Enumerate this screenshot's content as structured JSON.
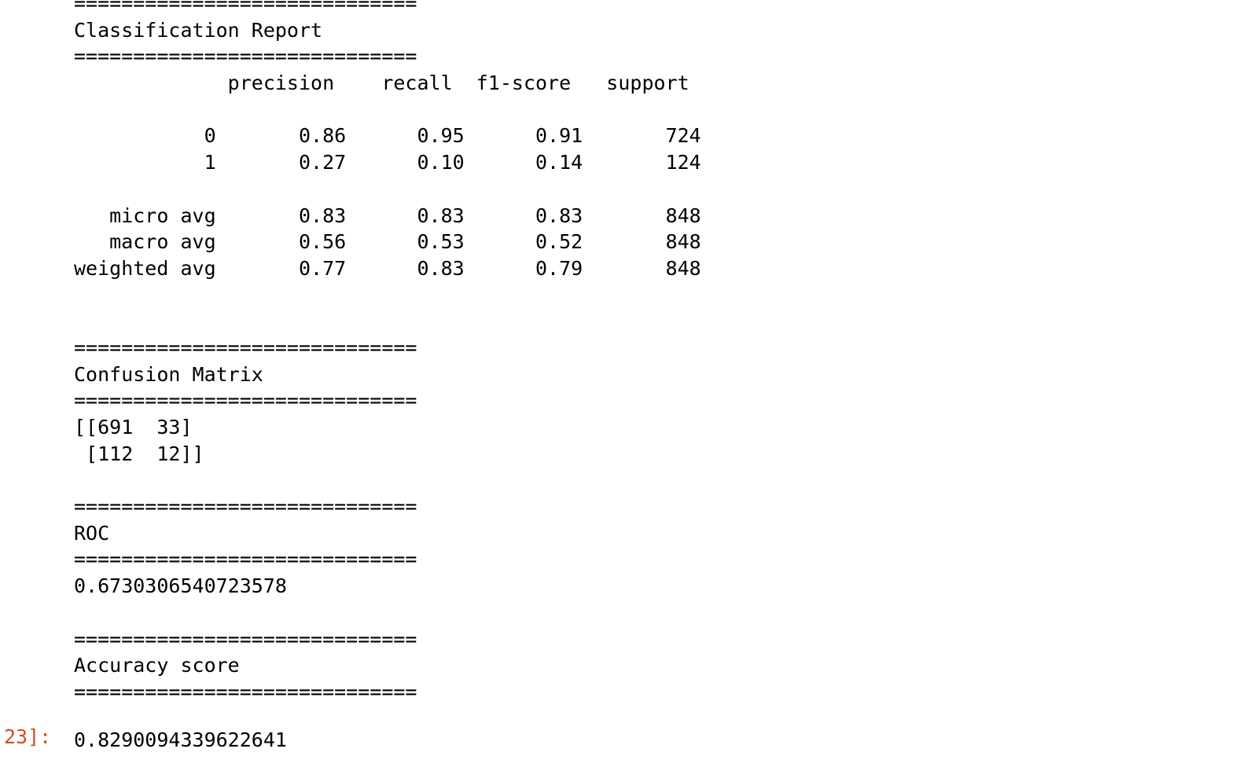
{
  "output": {
    "lines": [
      "=============================",
      "Classification Report",
      "=============================",
      "             precision    recall  f1-score   support",
      "",
      "           0       0.86      0.95      0.91       724",
      "           1       0.27      0.10      0.14       124",
      "",
      "   micro avg       0.83      0.83      0.83       848",
      "   macro avg       0.56      0.53      0.52       848",
      "weighted avg       0.77      0.83      0.79       848",
      "",
      "",
      "=============================",
      "Confusion Matrix",
      "=============================",
      "[[691  33]",
      " [112  12]]",
      "",
      "=============================",
      "ROC",
      "=============================",
      "0.6730306540723578",
      "",
      "=============================",
      "Accuracy score",
      "============================="
    ],
    "prompt": "23]:",
    "result": "0.8290094339622641"
  },
  "colors": {
    "prompt": "#d84a22",
    "text": "#000000",
    "background": "#ffffff"
  }
}
